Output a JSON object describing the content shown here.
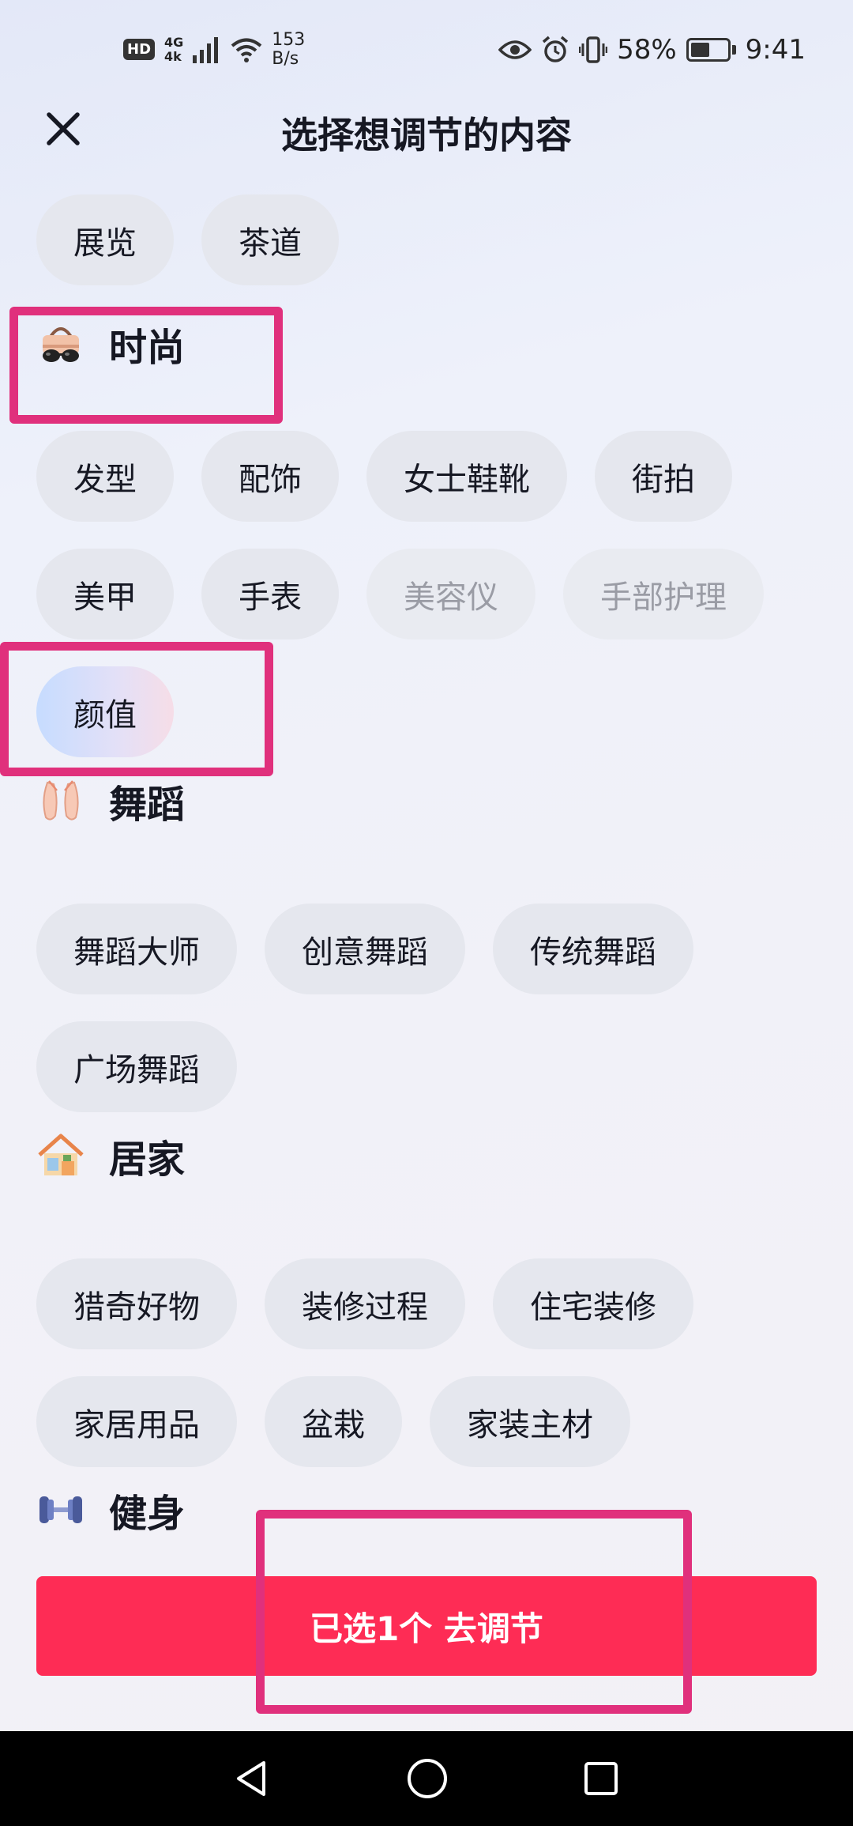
{
  "status_bar": {
    "hd": "HD",
    "network": "4G",
    "network_sub": "4k",
    "speed_value": "153",
    "speed_unit": "B/s",
    "battery_percent": "58%",
    "battery_level": 0.58,
    "time": "9:41"
  },
  "header": {
    "title": "选择想调节的内容",
    "close_icon": "close-icon"
  },
  "sections": {
    "top": {
      "chips": [
        {
          "label": "展览",
          "state": "normal"
        },
        {
          "label": "茶道",
          "state": "normal"
        }
      ]
    },
    "fashion": {
      "icon": "sunglasses-handbag-icon",
      "title": "时尚",
      "chips": [
        {
          "label": "发型",
          "state": "normal"
        },
        {
          "label": "配饰",
          "state": "normal"
        },
        {
          "label": "女士鞋靴",
          "state": "normal"
        },
        {
          "label": "街拍",
          "state": "normal"
        },
        {
          "label": "美甲",
          "state": "normal"
        },
        {
          "label": "手表",
          "state": "normal"
        },
        {
          "label": "美容仪",
          "state": "disabled"
        },
        {
          "label": "手部护理",
          "state": "disabled"
        },
        {
          "label": "颜值",
          "state": "selected"
        }
      ]
    },
    "dance": {
      "icon": "ballet-shoes-icon",
      "title": "舞蹈",
      "chips": [
        {
          "label": "舞蹈大师",
          "state": "normal"
        },
        {
          "label": "创意舞蹈",
          "state": "normal"
        },
        {
          "label": "传统舞蹈",
          "state": "normal"
        },
        {
          "label": "广场舞蹈",
          "state": "normal"
        }
      ]
    },
    "home": {
      "icon": "house-icon",
      "title": "居家",
      "chips": [
        {
          "label": "猎奇好物",
          "state": "normal"
        },
        {
          "label": "装修过程",
          "state": "normal"
        },
        {
          "label": "住宅装修",
          "state": "normal"
        },
        {
          "label": "家居用品",
          "state": "normal"
        },
        {
          "label": "盆栽",
          "state": "normal"
        },
        {
          "label": "家装主材",
          "state": "normal"
        }
      ]
    },
    "fitness": {
      "icon": "dumbbell-icon",
      "title": "健身"
    }
  },
  "cta": {
    "label": "已选1个 去调节"
  },
  "nav": {
    "back_icon": "back-triangle-icon",
    "home_icon": "home-circle-icon",
    "recents_icon": "recents-square-icon"
  },
  "colors": {
    "accent": "#fe2c55",
    "highlight_box": "#e0307c",
    "chip_bg": "#e5e7ee",
    "chip_disabled_text": "#9a9ca5"
  }
}
